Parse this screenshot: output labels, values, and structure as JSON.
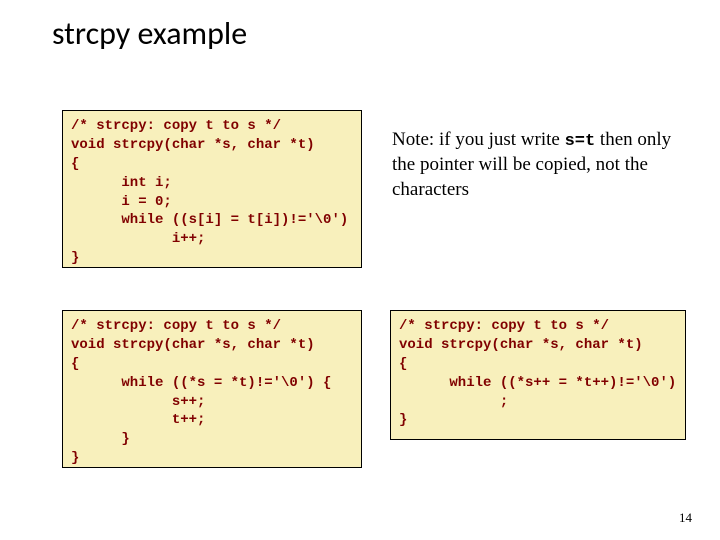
{
  "title": "strcpy example",
  "code1": "/* strcpy: copy t to s */\nvoid strcpy(char *s, char *t)\n{\n      int i;\n      i = 0;\n      while ((s[i] = t[i])!='\\0')\n            i++;\n}",
  "note_prefix": "Note: if you just write ",
  "note_code": "s=t",
  "note_suffix": "  then only the pointer will be copied, not the characters",
  "code3": "/* strcpy: copy t to s */\nvoid strcpy(char *s, char *t)\n{\n      while ((*s = *t)!='\\0') {\n            s++;\n            t++;\n      }\n}",
  "code4": "/* strcpy: copy t to s */\nvoid strcpy(char *s, char *t)\n{\n      while ((*s++ = *t++)!='\\0')\n            ;\n}",
  "page": "14"
}
